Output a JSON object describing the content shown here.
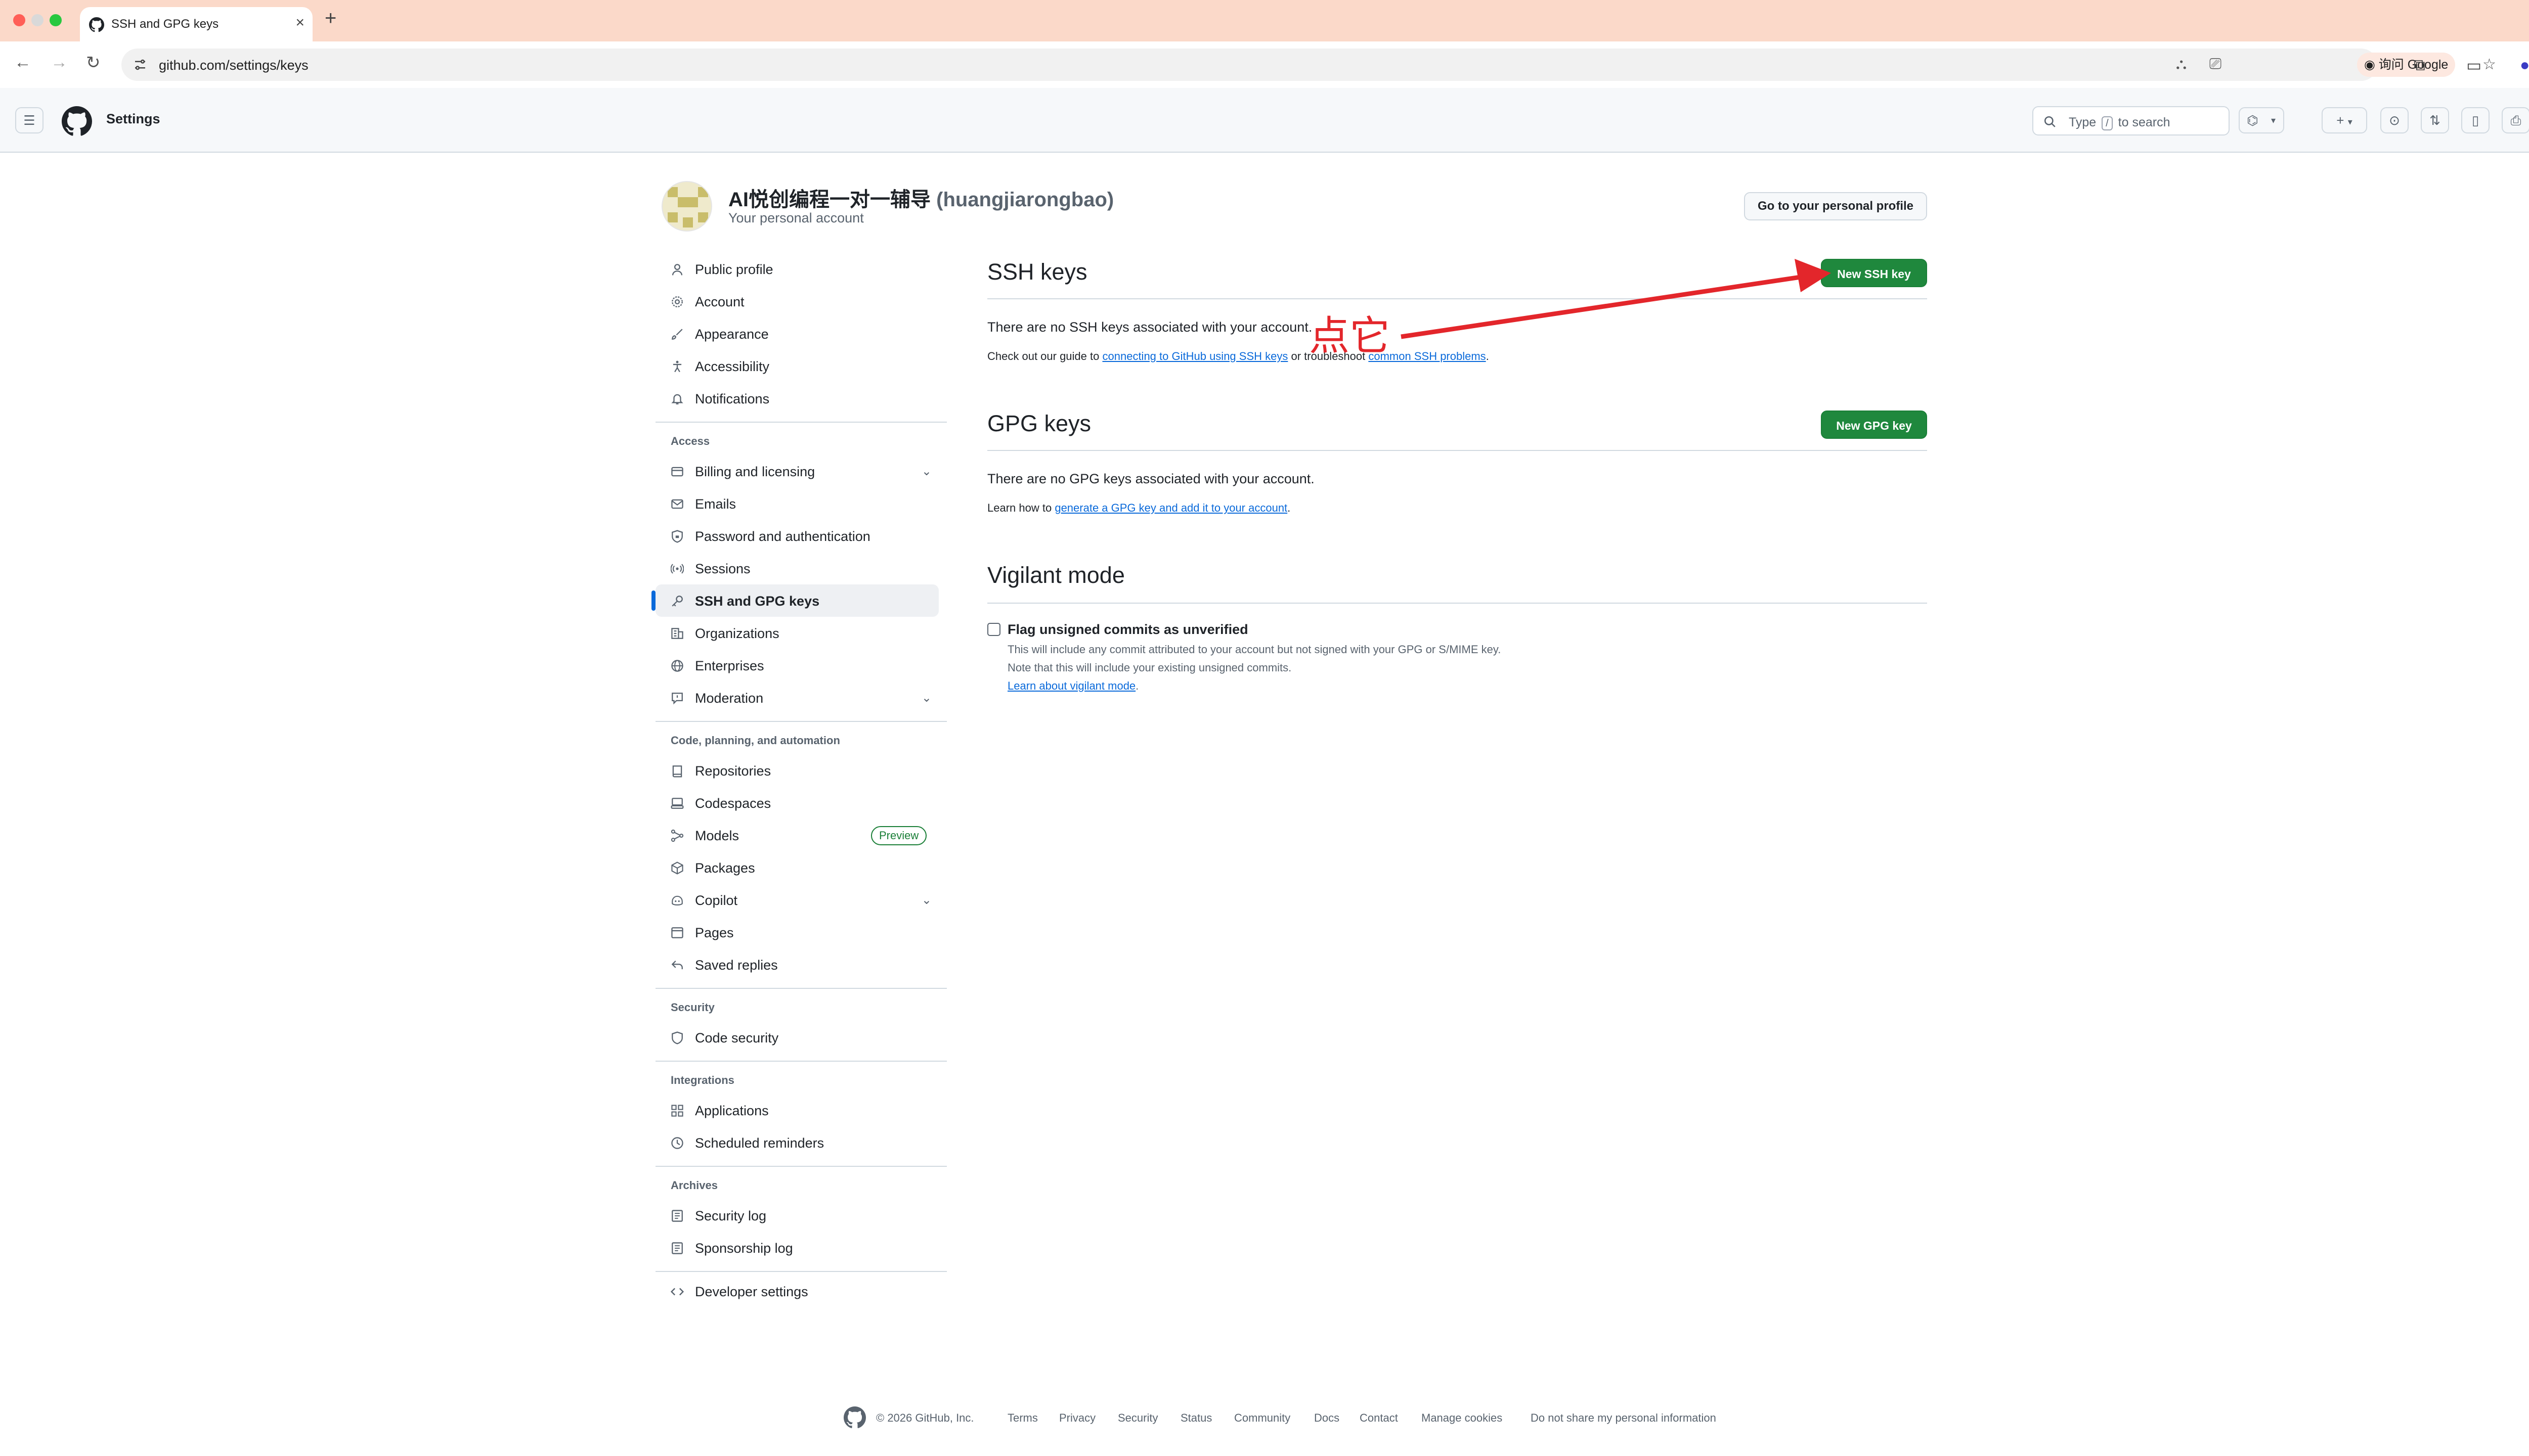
{
  "browser": {
    "tab_title": "SSH and GPG keys",
    "url": "github.com/settings/keys",
    "ask_google": "询问 Google"
  },
  "header": {
    "title": "Settings",
    "search": {
      "prefix": "Type",
      "key": "/",
      "suffix": "to search"
    }
  },
  "profile": {
    "name": "AI悦创编程一对一辅导",
    "handle": "(huangjiarongbao)",
    "subtitle": "Your personal account",
    "profile_button": "Go to your personal profile"
  },
  "sidebar": {
    "top_items": [
      {
        "label": "Public profile",
        "icon": "person-icon"
      },
      {
        "label": "Account",
        "icon": "gear-icon"
      },
      {
        "label": "Appearance",
        "icon": "paintbrush-icon"
      },
      {
        "label": "Accessibility",
        "icon": "accessibility-icon"
      },
      {
        "label": "Notifications",
        "icon": "bell-icon"
      }
    ],
    "access_label": "Access",
    "access_items": [
      {
        "label": "Billing and licensing",
        "icon": "credit-card-icon"
      },
      {
        "label": "Emails",
        "icon": "mail-icon"
      },
      {
        "label": "Password and authentication",
        "icon": "shield-lock-icon"
      },
      {
        "label": "Sessions",
        "icon": "broadcast-icon"
      },
      {
        "label": "SSH and GPG keys",
        "icon": "key-icon"
      },
      {
        "label": "Organizations",
        "icon": "organization-icon"
      },
      {
        "label": "Enterprises",
        "icon": "globe-icon"
      },
      {
        "label": "Moderation",
        "icon": "report-icon"
      }
    ],
    "code_label": "Code, planning, and automation",
    "code_items": [
      {
        "label": "Repositories",
        "icon": "repo-icon"
      },
      {
        "label": "Codespaces",
        "icon": "codespaces-icon"
      },
      {
        "label": "Models",
        "icon": "models-icon"
      },
      {
        "label": "Packages",
        "icon": "package-icon"
      },
      {
        "label": "Copilot",
        "icon": "copilot-icon"
      },
      {
        "label": "Pages",
        "icon": "browser-icon"
      },
      {
        "label": "Saved replies",
        "icon": "reply-icon"
      }
    ],
    "preview_badge": "Preview",
    "security_label": "Security",
    "security_items": [
      {
        "label": "Code security",
        "icon": "shield-check-icon"
      }
    ],
    "integrations_label": "Integrations",
    "integrations_items": [
      {
        "label": "Applications",
        "icon": "apps-icon"
      },
      {
        "label": "Scheduled reminders",
        "icon": "clock-icon"
      }
    ],
    "archives_label": "Archives",
    "archives_items": [
      {
        "label": "Security log",
        "icon": "log-icon"
      },
      {
        "label": "Sponsorship log",
        "icon": "log-icon"
      }
    ],
    "developer_settings": "Developer settings"
  },
  "ssh": {
    "title": "SSH keys",
    "button": "New SSH key",
    "empty": "There are no SSH keys associated with your account.",
    "guide_prefix": "Check out our guide to",
    "guide_link": "connecting to GitHub using SSH keys",
    "guide_middle": "or troubleshoot",
    "guide_link2": "common SSH problems",
    "guide_end": "."
  },
  "gpg": {
    "title": "GPG keys",
    "button": "New GPG key",
    "empty": "There are no GPG keys associated with your account.",
    "learn_prefix": "Learn how to",
    "learn_link": "generate a GPG key and add it to your account",
    "learn_end": "."
  },
  "vigilant": {
    "title": "Vigilant mode",
    "checkbox_label": "Flag unsigned commits as unverified",
    "checked": false,
    "note1": "This will include any commit attributed to your account but not signed with your GPG or S/MIME key.",
    "note2": "Note that this will include your existing unsigned commits.",
    "learn_link": "Learn about vigilant mode",
    "learn_end": "."
  },
  "annotation": {
    "text": "点它",
    "color": "#e3262b"
  },
  "footer": {
    "copyright": "© 2026 GitHub, Inc.",
    "links": [
      "Terms",
      "Privacy",
      "Security",
      "Status",
      "Community",
      "Docs",
      "Contact",
      "Manage cookies",
      "Do not share my personal information"
    ]
  },
  "colors": {
    "accent": "#0969da",
    "primary_button": "#1f883d",
    "tab_strip": "#fbd9c9"
  }
}
